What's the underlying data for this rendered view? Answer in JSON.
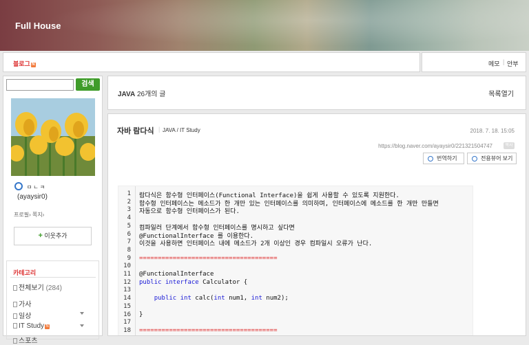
{
  "banner": {
    "title": "Full House"
  },
  "nav": {
    "blog": "블로그",
    "blog_badge": "N",
    "memo": "메모",
    "separator": "|",
    "guestbook": "안부"
  },
  "sidebar": {
    "search_button": "검색",
    "search_placeholder": "",
    "nickname": "ㅁㄴㅋ",
    "username": "(ayaysir0)",
    "profile_links": "프로필› 쪽지›",
    "neighbor_button": "이웃추가",
    "neighbor_plus": "+",
    "category_title": "카테고리",
    "categories": [
      {
        "label": "전체보기",
        "count": "(284)"
      },
      {
        "label": "가사",
        "count": ""
      },
      {
        "label": "일상",
        "count": ""
      },
      {
        "label": "IT Study",
        "count": "",
        "badge": "N"
      },
      {
        "label": "스포츠",
        "count": ""
      }
    ]
  },
  "header": {
    "category": "JAVA",
    "count_text": "26개의 글",
    "toggle_list": "목록열기"
  },
  "post": {
    "title": "자바 람다식",
    "title_sep": "|",
    "category": "JAVA / IT Study",
    "date": "2018. 7. 18. 15:05",
    "url": "https://blog.naver.com/ayaysir0/221321504747",
    "url_badge": "복사",
    "translate_button": "번역하기",
    "viewer_button": "전용뷰어 보기"
  },
  "code": {
    "line_numbers": [
      "1",
      "2",
      "3",
      "4",
      "5",
      "6",
      "7",
      "8",
      "9",
      "10",
      "11",
      "12",
      "13",
      "14",
      "15",
      "16",
      "17",
      "18"
    ],
    "lines": [
      "람다식은 함수형 인터페이스(Functional Interface)을 쉽게 사용할 수 있도록 지원한다.",
      "함수형 인터페이스는 메소드가 한 개만 있는 인터페이스를 의미하며, 인터페이스에 메소드를 한 개만 만들면",
      "자동으로 함수형 인터페이스가 된다.",
      "",
      "컴파일러 단계에서 함수형 인터페이스를 명시하고 싶다면",
      "@FunctionalInterface 를 이용한다.",
      "이것을 사용하면 인터페이스 내에 메소드가 2개 이상인 경우 컴파일시 오류가 난다.",
      "",
      "=====================================",
      "",
      "@FunctionalInterface",
      "",
      "",
      "",
      "",
      "}",
      "",
      "====================================="
    ],
    "l12_kw1": "public",
    "l12_kw2": "interface",
    "l12_rest": " Calculator {",
    "l14_kw1": "public",
    "l14_kw2": "int",
    "l14_mid": " calc(",
    "l14_kw3": "int",
    "l14_mid2": " num1, ",
    "l14_kw4": "int",
    "l14_end": " num2);"
  }
}
